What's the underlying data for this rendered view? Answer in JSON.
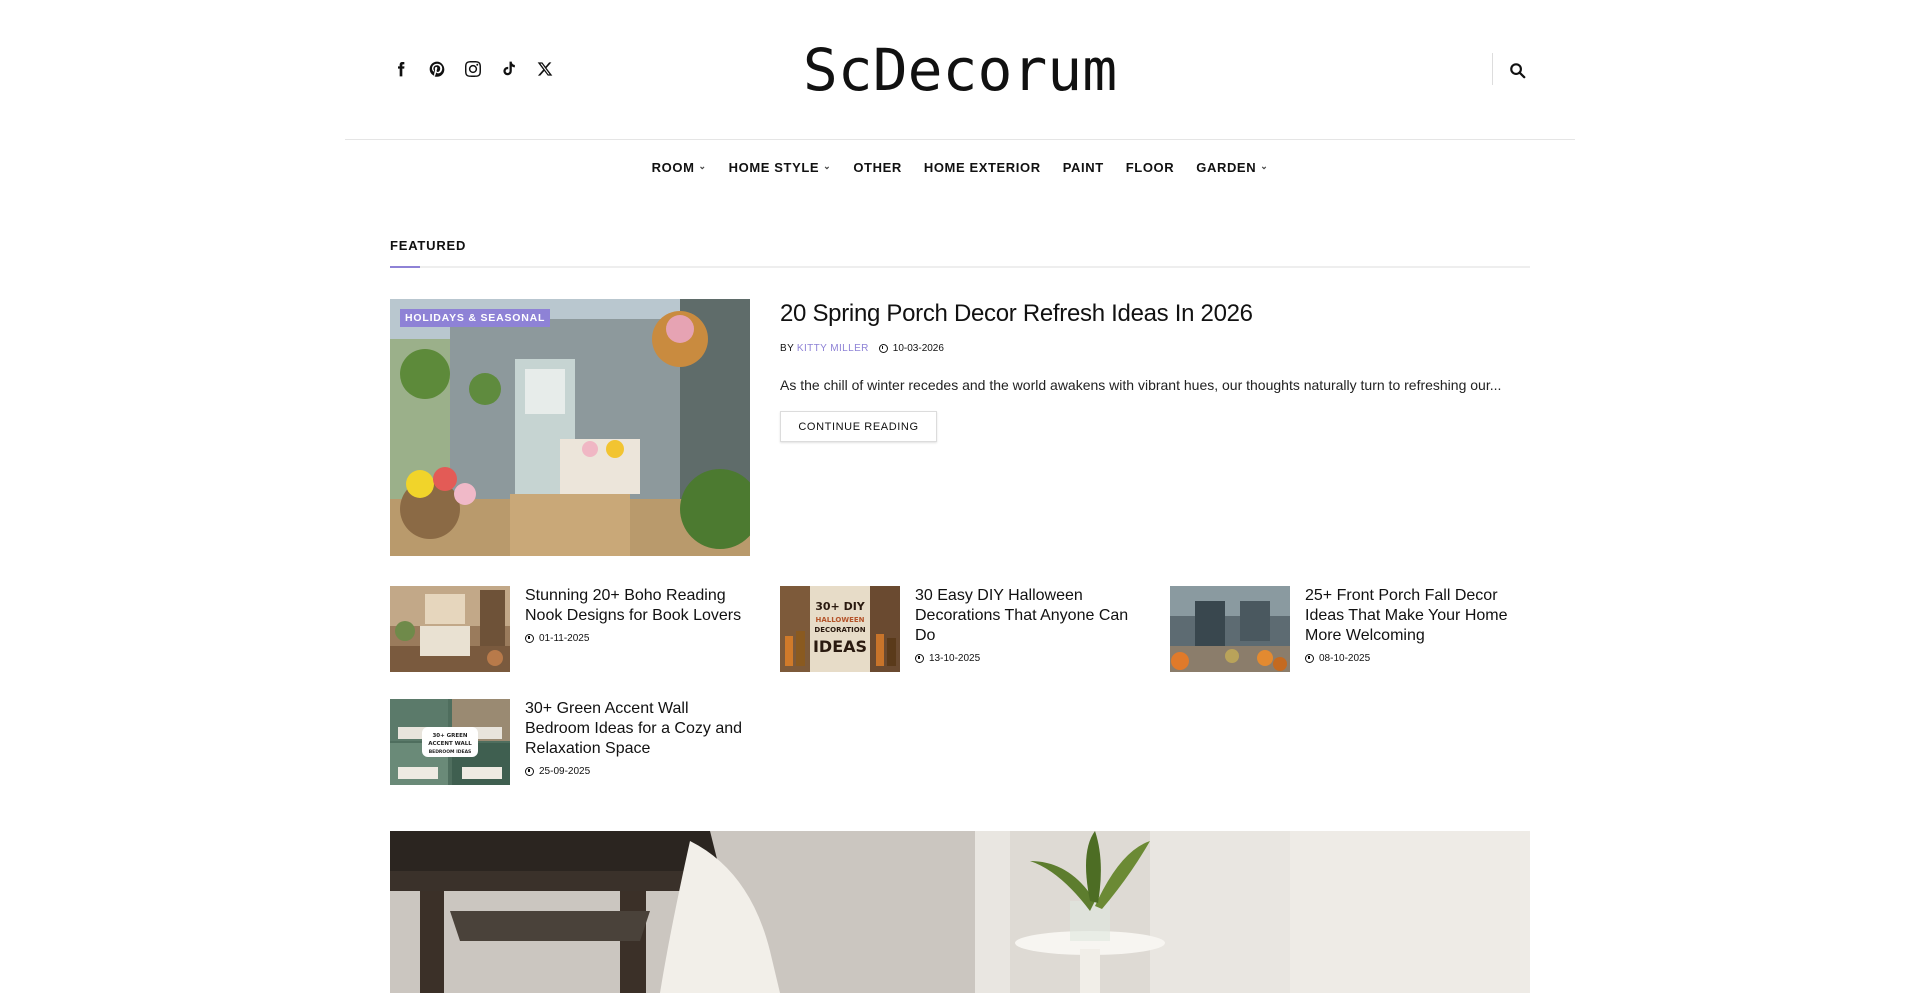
{
  "site": {
    "logo": "ScDecorum"
  },
  "socials": [
    "facebook-icon",
    "pinterest-icon",
    "instagram-icon",
    "tiktok-icon",
    "x-icon"
  ],
  "nav": [
    {
      "label": "ROOM",
      "dropdown": true
    },
    {
      "label": "HOME STYLE",
      "dropdown": true
    },
    {
      "label": "OTHER",
      "dropdown": false
    },
    {
      "label": "HOME EXTERIOR",
      "dropdown": false
    },
    {
      "label": "PAINT",
      "dropdown": false
    },
    {
      "label": "FLOOR",
      "dropdown": false
    },
    {
      "label": "GARDEN",
      "dropdown": true
    }
  ],
  "section": {
    "title": "FEATURED"
  },
  "featured": {
    "category": "HOLIDAYS & SEASONAL",
    "title": "20 Spring Porch Decor Refresh Ideas In 2026",
    "by": "BY",
    "author": "KITTY MILLER",
    "date": "10-03-2026",
    "excerpt": "As the chill of winter recedes and the world awakens with vibrant hues, our thoughts naturally turn to refreshing our...",
    "button": "CONTINUE READING"
  },
  "posts": [
    {
      "title": "Stunning 20+ Boho Reading Nook Designs for Book Lovers",
      "date": "01-11-2025"
    },
    {
      "title": "30 Easy DIY Halloween Decorations That Anyone Can Do",
      "date": "13-10-2025",
      "thumb_text": [
        "30+ DIY",
        "HALLOWEEN",
        "DECORATION",
        "IDEAS"
      ]
    },
    {
      "title": "25+ Front Porch Fall Decor Ideas That Make Your Home More Welcoming",
      "date": "08-10-2025"
    },
    {
      "title": "30+ Green Accent Wall Bedroom Ideas for a Cozy and Relaxation Space",
      "date": "25-09-2025",
      "thumb_text": [
        "30+ GREEN",
        "ACCENT WALL",
        "BEDROOM IDEAS"
      ]
    }
  ],
  "colors": {
    "accent": "#8e82d6",
    "text": "#111111",
    "border": "#e5e5e5"
  }
}
